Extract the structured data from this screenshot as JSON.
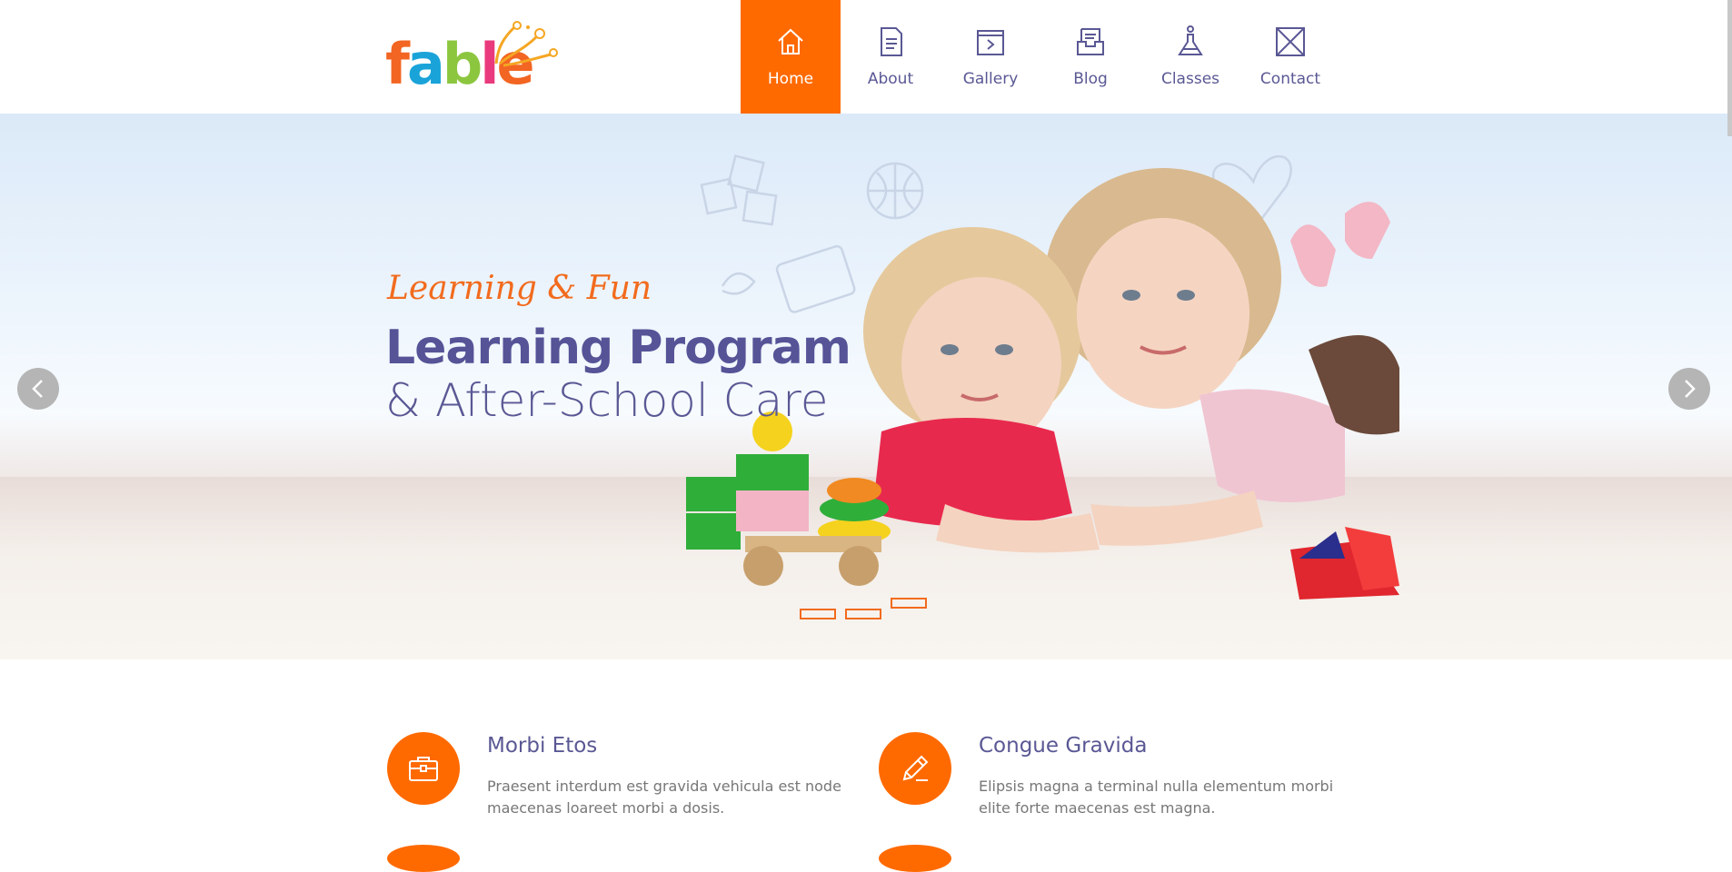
{
  "logo": {
    "text": "fable"
  },
  "nav": {
    "items": [
      {
        "label": "Home",
        "icon": "home-icon",
        "active": true
      },
      {
        "label": "About",
        "icon": "document-icon",
        "active": false
      },
      {
        "label": "Gallery",
        "icon": "gallery-icon",
        "active": false
      },
      {
        "label": "Blog",
        "icon": "inbox-icon",
        "active": false
      },
      {
        "label": "Classes",
        "icon": "flask-icon",
        "active": false
      },
      {
        "label": "Contact",
        "icon": "envelope-icon",
        "active": false
      }
    ]
  },
  "hero": {
    "subtitle": "Learning & Fun",
    "title": "Learning Program",
    "title2": "& After-School Care",
    "slides": 3,
    "active_slide": 3
  },
  "features": [
    {
      "title": "Morbi Etos",
      "text": "Praesent interdum est gravida vehicula est node maecenas loareet morbi a dosis.",
      "icon": "briefcase-icon"
    },
    {
      "title": "Congue Gravida",
      "text": "Elipsis magna a terminal nulla elementum morbi elite forte maecenas est magna.",
      "icon": "pencil-icon"
    }
  ],
  "colors": {
    "accent": "#ff6a00",
    "brand_purple": "#5a5894",
    "subtitle_orange": "#f26b1d"
  }
}
